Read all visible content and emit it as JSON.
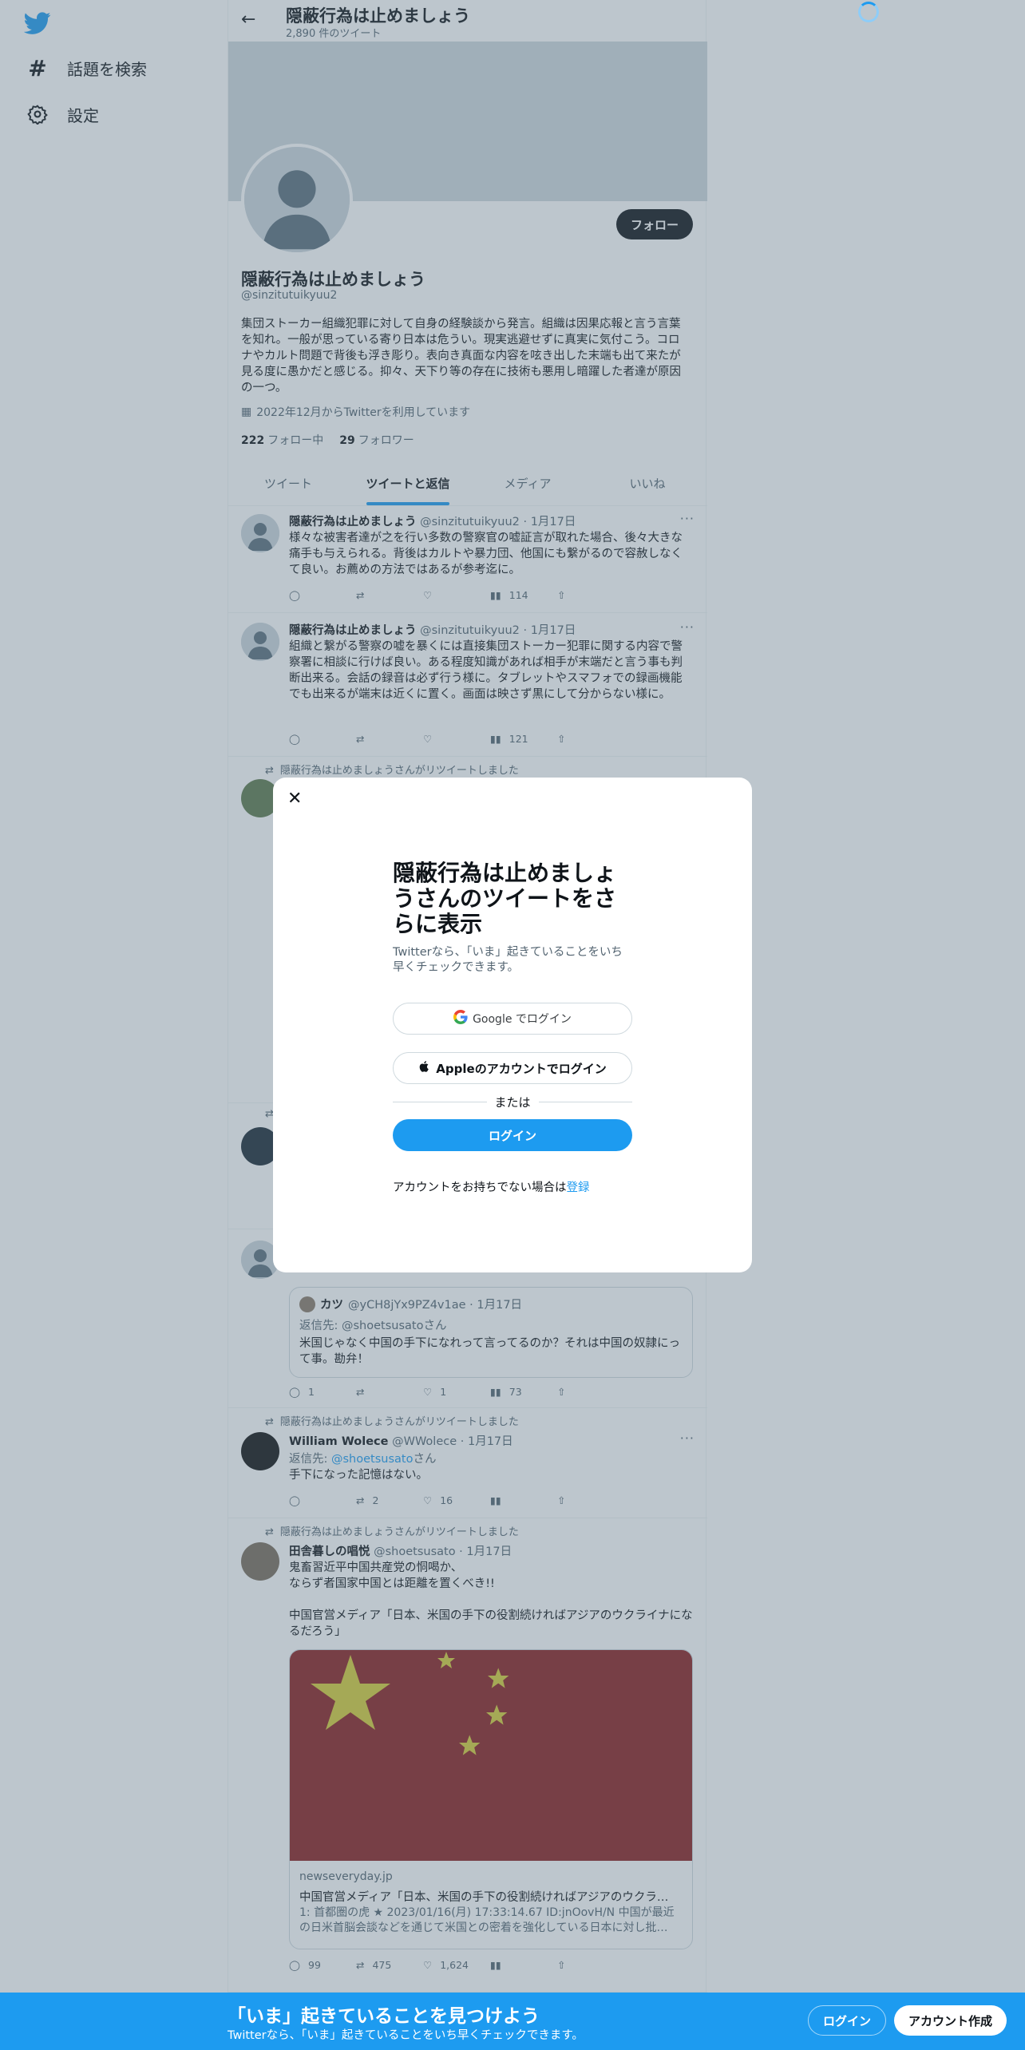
{
  "nav": {
    "items": [
      {
        "label": "話題を検索",
        "icon": "hashtag-icon"
      },
      {
        "label": "設定",
        "icon": "gear-icon"
      }
    ]
  },
  "profile": {
    "name": "隠蔽行為は止めましょう",
    "tweet_count": "2,890 件のツイート",
    "handle": "@sinzitutuikyuu2",
    "follow_label": "フォロー",
    "bio": "集団ストーカー組織犯罪に対して自身の経験談から発言。組織は因果応報と言う言葉を知れ。一般が思っている寄り日本は危うい。現実逃避せずに真実に気付こう。コロナやカルト問題で背後も浮き彫り。表向き真面な内容を呟き出した末端も出て来たが見る度に愚かだと感じる。抑々、天下り等の存在に技術も悪用し暗躍した者達が原因の一つ。",
    "joined": "2022年12月からTwitterを利用しています",
    "following_count": "222",
    "following_label": "フォロー中",
    "followers_count": "29",
    "followers_label": "フォロワー"
  },
  "tabs": [
    "ツイート",
    "ツイートと返信",
    "メディア",
    "いいね"
  ],
  "tweets": [
    {
      "name": "隠蔽行為は止めましょう",
      "meta": "@sinzitutuikyuu2 · 1月17日",
      "text": "様々な被害者達が之を行い多数の警察官の嘘証言が取れた場合、後々大きな痛手も与えられる。背後はカルトや暴力団、他国にも繋がるので容赦しなくて良い。お薦めの方法ではあるが参考迄に。",
      "views": "114"
    },
    {
      "name": "隠蔽行為は止めましょう",
      "meta": "@sinzitutuikyuu2 · 1月17日",
      "text": "組織と繋がる警察の嘘を暴くには直接集団ストーカー犯罪に関する内容で警察署に相談に行けば良い。ある程度知識があれば相手が末端だと言う事も判断出来る。会話の録音は必ず行う様に。タブレットやスマフォでの録画機能でも出来るが端末は近くに置く。画面は映さず黒にして分からない様に。",
      "views": "121"
    }
  ],
  "retweet_label": "隠蔽行為は止めましょうさんがリツイートしました",
  "quote_tweet": {
    "name": "カツ",
    "meta": "@yCH8jYx9PZ4v1ae · 1月17日",
    "reply_prefix": "返信先: ",
    "reply_handle": "@shoetsusato",
    "reply_suffix": "さん",
    "text": "米国じゃなく中国の手下になれって言ってるのか？それは中国の奴隷にって事。勘弁！",
    "replies": "1",
    "likes": "1",
    "views": "73"
  },
  "tweet_wolece": {
    "name": "William Wolece",
    "meta": "@WWolece · 1月17日",
    "reply_prefix": "返信先: ",
    "reply_handle": "@shoetsusato",
    "reply_suffix": "さん",
    "text": "手下になった記憶はない。",
    "retweets": "2",
    "likes": "16"
  },
  "tweet_inaka": {
    "name": "田舎暮しの唱悦",
    "meta": "@shoetsusato · 1月17日",
    "text": "鬼畜習近平中国共産党の恫喝か、\nならず者国家中国とは距離を置くべき!!\n\n中国官営メディア「日本、米国の手下の役割続ければアジアのウクライナになるだろう」",
    "card_domain": "newseveryday.jp",
    "card_title": "中国官営メディア「日本、米国の手下の役割続ければアジアのウクラ…",
    "card_desc": "1: 首都圏の虎 ★ 2023/01/16(月) 17:33:14.67 ID:jnOovH/N 中国が最近の日米首脳会談などを通じて米国との密着を強化している日本に対し批…",
    "replies": "99",
    "retweets": "475",
    "likes": "1,624"
  },
  "modal": {
    "title": "隠蔽行為は止めましょうさんのツイートをさらに表示",
    "subtitle": "Twitterなら、「いま」起きていることをいち早くチェックできます。",
    "google_label": "Google でログイン",
    "apple_label": "Appleのアカウントでログイン",
    "or_label": "または",
    "login_label": "ログイン",
    "footer_text": "アカウントをお持ちでない場合は",
    "footer_link": "登録"
  },
  "bottom_bar": {
    "title": "「いま」起きていることを見つけよう",
    "subtitle": "Twitterなら、「いま」起きていることをいち早くチェックできます。",
    "login_label": "ログイン",
    "signup_label": "アカウント作成"
  },
  "colors": {
    "accent": "#1d9bf0",
    "text": "#0f1419",
    "muted": "#536471",
    "flag_red": "#8b1e1e",
    "flag_yellow": "#d8cf3a"
  }
}
